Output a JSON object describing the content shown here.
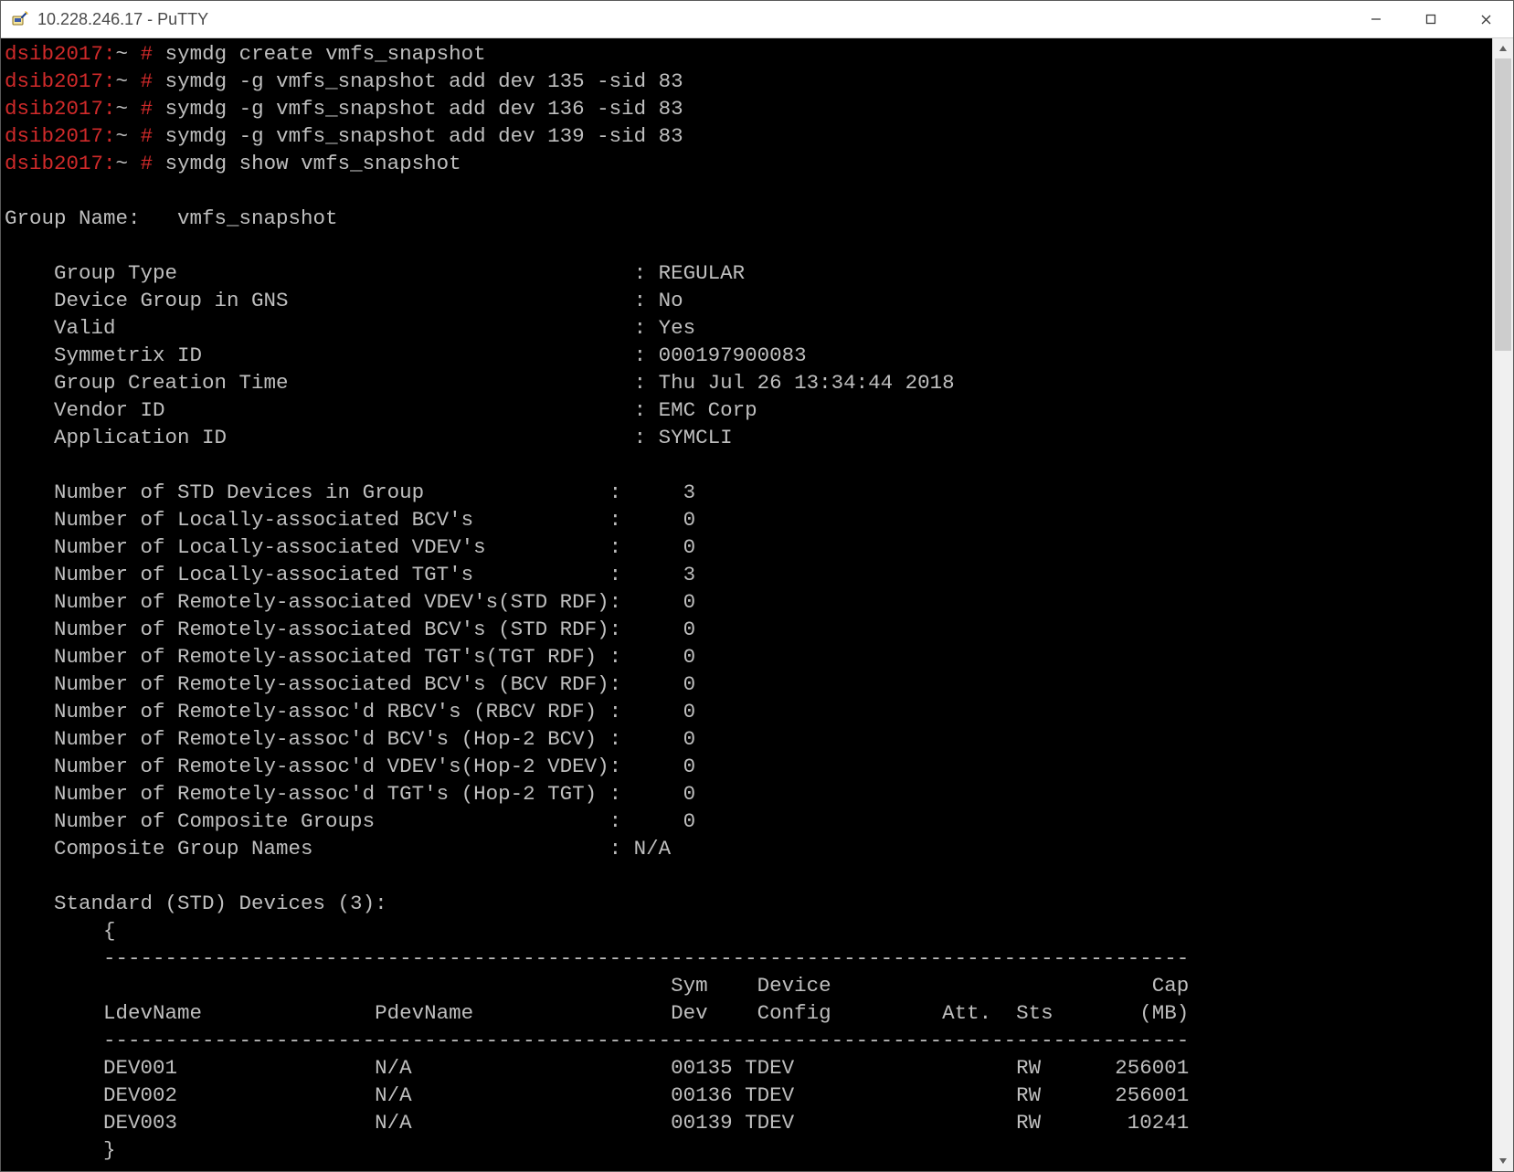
{
  "window": {
    "title": "10.228.246.17 - PuTTY"
  },
  "prompt": {
    "host": "dsib2017:",
    "path": "~",
    "symbol": "#"
  },
  "commands": [
    "symdg create vmfs_snapshot",
    "symdg -g vmfs_snapshot add dev 135 -sid 83",
    "symdg -g vmfs_snapshot add dev 136 -sid 83",
    "symdg -g vmfs_snapshot add dev 139 -sid 83",
    "symdg show vmfs_snapshot"
  ],
  "group": {
    "name_label": "Group Name:",
    "name_value": "vmfs_snapshot",
    "attrs": [
      {
        "label": "Group Type",
        "value": "REGULAR"
      },
      {
        "label": "Device Group in GNS",
        "value": "No"
      },
      {
        "label": "Valid",
        "value": "Yes"
      },
      {
        "label": "Symmetrix ID",
        "value": "000197900083"
      },
      {
        "label": "Group Creation Time",
        "value": "Thu Jul 26 13:34:44 2018"
      },
      {
        "label": "Vendor ID",
        "value": "EMC Corp"
      },
      {
        "label": "Application ID",
        "value": "SYMCLI"
      }
    ],
    "counts": [
      {
        "label": "Number of STD Devices in Group",
        "value": "3"
      },
      {
        "label": "Number of Locally-associated BCV's",
        "value": "0"
      },
      {
        "label": "Number of Locally-associated VDEV's",
        "value": "0"
      },
      {
        "label": "Number of Locally-associated TGT's",
        "value": "3"
      },
      {
        "label": "Number of Remotely-associated VDEV's(STD RDF)",
        "value": "0"
      },
      {
        "label": "Number of Remotely-associated BCV's (STD RDF)",
        "value": "0"
      },
      {
        "label": "Number of Remotely-associated TGT's(TGT RDF) ",
        "value": "0"
      },
      {
        "label": "Number of Remotely-associated BCV's (BCV RDF)",
        "value": "0"
      },
      {
        "label": "Number of Remotely-assoc'd RBCV's (RBCV RDF) ",
        "value": "0"
      },
      {
        "label": "Number of Remotely-assoc'd BCV's (Hop-2 BCV) ",
        "value": "0"
      },
      {
        "label": "Number of Remotely-assoc'd VDEV's(Hop-2 VDEV)",
        "value": "0"
      },
      {
        "label": "Number of Remotely-assoc'd TGT's (Hop-2 TGT) ",
        "value": "0"
      },
      {
        "label": "Number of Composite Groups",
        "value": "0"
      },
      {
        "label": "Composite Group Names",
        "value": "N/A",
        "text": true
      }
    ],
    "std_section_title": "Standard (STD) Devices (3):",
    "table": {
      "hdr1": {
        "sym": "Sym",
        "device": "Device",
        "cap": "Cap"
      },
      "hdr2": {
        "ldev": "LdevName",
        "pdev": "PdevName",
        "dev": "Dev",
        "config": "Config",
        "att": "Att.",
        "sts": "Sts",
        "mb": "(MB)"
      },
      "rows": [
        {
          "ldev": "DEV001",
          "pdev": "N/A",
          "dev": "00135",
          "config": "TDEV",
          "sts": "RW",
          "mb": "256001"
        },
        {
          "ldev": "DEV002",
          "pdev": "N/A",
          "dev": "00136",
          "config": "TDEV",
          "sts": "RW",
          "mb": "256001"
        },
        {
          "ldev": "DEV003",
          "pdev": "N/A",
          "dev": "00139",
          "config": "TDEV",
          "sts": "RW",
          "mb": "10241"
        }
      ]
    }
  }
}
